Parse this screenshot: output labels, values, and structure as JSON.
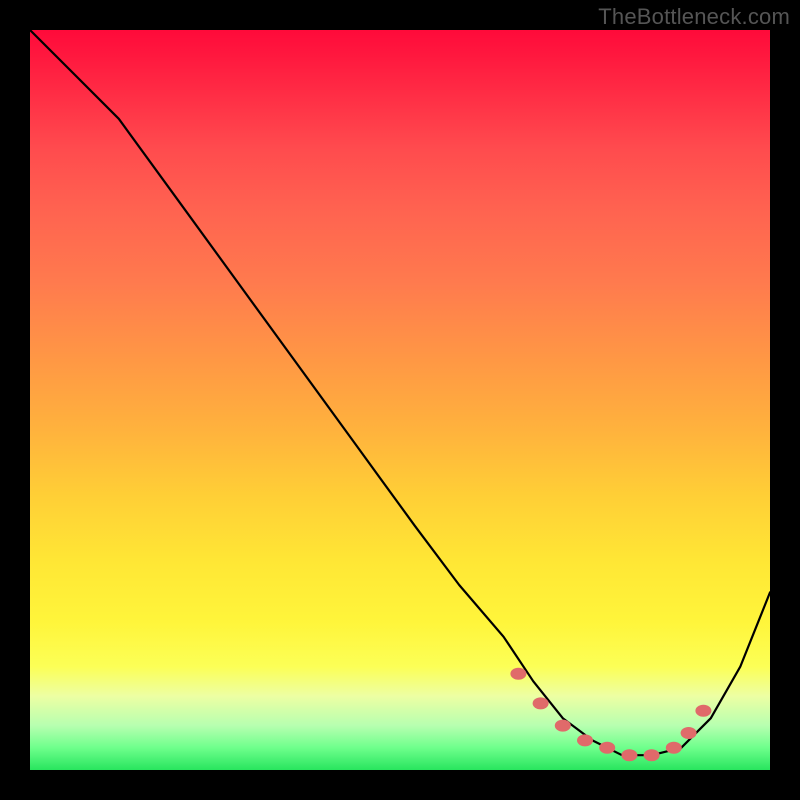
{
  "watermark": "TheBottleneck.com",
  "colors": {
    "page_bg": "#000000",
    "watermark_text": "#555555",
    "curve_stroke": "#000000",
    "marker_fill": "#e06a6a",
    "gradient_stops": [
      "#ff0a3a",
      "#ff2a44",
      "#ff4b4e",
      "#ff6250",
      "#ff7a4e",
      "#ff9645",
      "#ffb23d",
      "#ffcf36",
      "#ffe735",
      "#fff53b",
      "#fcff56",
      "#edffa3",
      "#b7ffb0",
      "#6eff8c",
      "#28e55e"
    ]
  },
  "chart_data": {
    "type": "line",
    "title": "",
    "xlabel": "",
    "ylabel": "",
    "xlim": [
      0,
      100
    ],
    "ylim": [
      0,
      100
    ],
    "grid": false,
    "legend": false,
    "series": [
      {
        "name": "curve",
        "x": [
          0,
          6,
          12,
          20,
          28,
          36,
          44,
          52,
          58,
          64,
          68,
          72,
          76,
          80,
          84,
          88,
          92,
          96,
          100
        ],
        "values": [
          100,
          94,
          88,
          77,
          66,
          55,
          44,
          33,
          25,
          18,
          12,
          7,
          4,
          2,
          2,
          3,
          7,
          14,
          24
        ]
      }
    ],
    "markers": {
      "name": "highlight-dots",
      "x": [
        66,
        69,
        72,
        75,
        78,
        81,
        84,
        87,
        89,
        91
      ],
      "values": [
        13,
        9,
        6,
        4,
        3,
        2,
        2,
        3,
        5,
        8
      ]
    }
  }
}
